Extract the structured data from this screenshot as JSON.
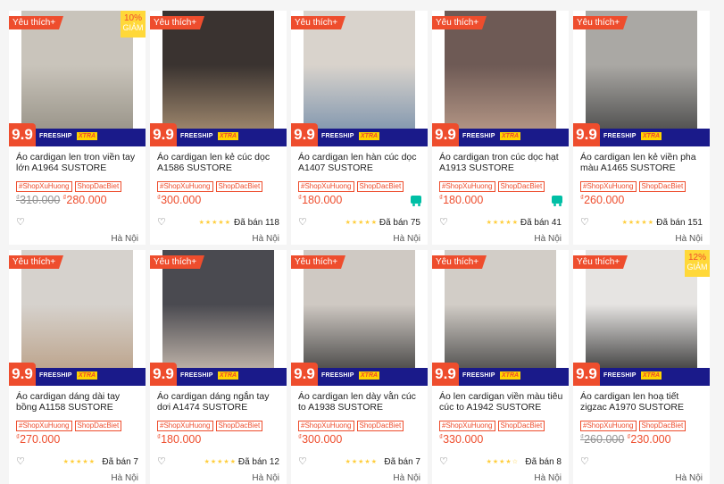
{
  "badges": {
    "favorite": "Yêu thích+",
    "nine": "9.9",
    "freeship": "FREESHIP",
    "xtra": "XTRA",
    "off_word": "GIẢM"
  },
  "colors": {
    "accent": "#ee4d2d",
    "star": "#ffce3d",
    "ship": "#00bfa5"
  },
  "products": [
    {
      "title": "Áo cardigan len tron viền tay lớn A1964 SUSTORE",
      "tags": [
        "#ShopXuHuong",
        "ShopDacBiet"
      ],
      "old_price": "310.000",
      "price": "280.000",
      "currency": "₫",
      "rating": "",
      "sold": "",
      "location": "Hà Nội",
      "discount": "10%",
      "free_ship": false,
      "favorite": true
    },
    {
      "title": "Áo cardigan len kẻ cúc dọc A1586 SUSTORE",
      "tags": [
        "#ShopXuHuong",
        "ShopDacBiet"
      ],
      "old_price": "",
      "price": "300.000",
      "currency": "₫",
      "rating": "★★★★★",
      "sold": "Đã bán 118",
      "location": "Hà Nội",
      "discount": "",
      "free_ship": false,
      "favorite": true
    },
    {
      "title": "Áo cardigan len hàn cúc dọc A1407 SUSTORE",
      "tags": [
        "#ShopXuHuong",
        "ShopDacBiet"
      ],
      "old_price": "",
      "price": "180.000",
      "currency": "₫",
      "rating": "★★★★★",
      "sold": "Đã bán 75",
      "location": "Hà Nội",
      "discount": "",
      "free_ship": true,
      "favorite": true
    },
    {
      "title": "Áo cardigan tron cúc dọc hạt A1913 SUSTORE",
      "tags": [
        "#ShopXuHuong",
        "ShopDacBiet"
      ],
      "old_price": "",
      "price": "180.000",
      "currency": "₫",
      "rating": "★★★★★",
      "sold": "Đã bán 41",
      "location": "Hà Nội",
      "discount": "",
      "free_ship": true,
      "favorite": true
    },
    {
      "title": "Áo cardigan len kẻ viền pha màu A1465 SUSTORE",
      "tags": [
        "#ShopXuHuong",
        "ShopDacBiet"
      ],
      "old_price": "",
      "price": "260.000",
      "currency": "₫",
      "rating": "★★★★★",
      "sold": "Đã bán 151",
      "location": "Hà Nội",
      "discount": "",
      "free_ship": false,
      "favorite": true
    },
    {
      "title": "Áo cardigan dáng dài tay bồng A1158 SUSTORE",
      "tags": [
        "#ShopXuHuong",
        "ShopDacBiet"
      ],
      "old_price": "",
      "price": "270.000",
      "currency": "₫",
      "rating": "★★★★★",
      "sold": "Đã bán 7",
      "location": "Hà Nội",
      "discount": "",
      "free_ship": false,
      "favorite": true
    },
    {
      "title": "Áo cardigan dáng ngắn tay dơi A1474 SUSTORE",
      "tags": [
        "#ShopXuHuong",
        "ShopDacBiet"
      ],
      "old_price": "",
      "price": "180.000",
      "currency": "₫",
      "rating": "★★★★★",
      "sold": "Đã bán 12",
      "location": "Hà Nội",
      "discount": "",
      "free_ship": false,
      "favorite": true
    },
    {
      "title": "Áo cardigan len dày vằn cúc to A1938 SUSTORE",
      "tags": [
        "#ShopXuHuong",
        "ShopDacBiet"
      ],
      "old_price": "",
      "price": "300.000",
      "currency": "₫",
      "rating": "★★★★★",
      "sold": "Đã bán 7",
      "location": "Hà Nội",
      "discount": "",
      "free_ship": false,
      "favorite": true
    },
    {
      "title": "Áo len cardigan viền màu tiêu cúc to A1942 SUSTORE",
      "tags": [
        "#ShopXuHuong",
        "ShopDacBiet"
      ],
      "old_price": "",
      "price": "330.000",
      "currency": "₫",
      "rating": "★★★★☆",
      "sold": "Đã bán 8",
      "location": "Hà Nội",
      "discount": "",
      "free_ship": false,
      "favorite": true
    },
    {
      "title": "Áo cardigan len hoạ tiết zigzac A1970 SUSTORE",
      "tags": [
        "#ShopXuHuong",
        "ShopDacBiet"
      ],
      "old_price": "260.000",
      "price": "230.000",
      "currency": "₫",
      "rating": "",
      "sold": "",
      "location": "Hà Nội",
      "discount": "12%",
      "free_ship": false,
      "favorite": true
    }
  ]
}
